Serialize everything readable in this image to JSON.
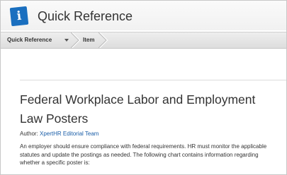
{
  "header": {
    "logo_letter": "i",
    "title": "Quick Reference"
  },
  "breadcrumb": {
    "items": [
      {
        "label": "Quick Reference"
      },
      {
        "label": "Item"
      }
    ]
  },
  "article": {
    "title": "Federal Workplace Labor and Employment Law Posters",
    "author_prefix": "Author: ",
    "author_name": "XpertHR Editorial Team",
    "intro": "An employer should ensure compliance with federal requirements. HR must monitor the applicable statutes and update the postings as needed. The following chart contains information regarding whether a specific poster is:"
  },
  "colors": {
    "brand_blue": "#1a6fbf",
    "link_blue": "#1a5ea8",
    "text": "#333333"
  }
}
